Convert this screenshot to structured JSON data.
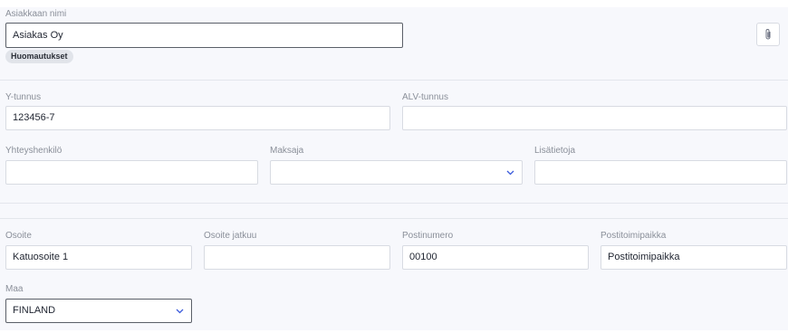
{
  "customer": {
    "name_label": "Asiakkaan nimi",
    "name_value": "Asiakas Oy",
    "notes_badge": "Huomautukset",
    "attach_icon": "paperclip-icon"
  },
  "company": {
    "business_id_label": "Y-tunnus",
    "business_id_value": "123456-7",
    "vat_id_label": "ALV-tunnus",
    "vat_id_value": ""
  },
  "contact": {
    "contact_person_label": "Yhteyshenkilö",
    "contact_person_value": "",
    "payer_label": "Maksaja",
    "payer_value": "",
    "extra_info_label": "Lisätietoja",
    "extra_info_value": ""
  },
  "address": {
    "street_label": "Osoite",
    "street_value": "Katuosoite 1",
    "street2_label": "Osoite jatkuu",
    "street2_value": "",
    "postal_code_label": "Postinumero",
    "postal_code_value": "00100",
    "city_label": "Postitoimipaikka",
    "city_value": "Postitoimipaikka",
    "country_label": "Maa",
    "country_value": "FINLAND"
  },
  "colors": {
    "panel_bg": "#f7f8fc",
    "chevron": "#3b5bdb"
  }
}
